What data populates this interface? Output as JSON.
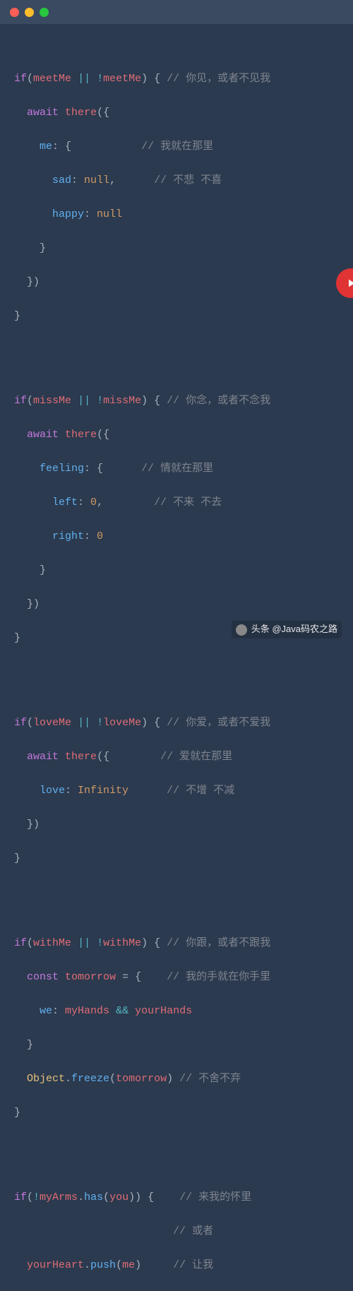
{
  "window": {
    "dots": [
      "close",
      "minimize",
      "zoom"
    ]
  },
  "blocks": [
    {
      "if_lhs": "meetMe",
      "if_rhs": "meetMe",
      "neg_rhs": true,
      "cmt_if": "你见，或者不见我",
      "await_call": "there",
      "nested_key": "me",
      "cmt_await": "我就在那里",
      "props": [
        {
          "name": "sad",
          "value": "null",
          "cmt": "不悲 不喜"
        },
        {
          "name": "happy",
          "value": "null"
        }
      ]
    },
    {
      "if_lhs": "missMe",
      "if_rhs": "missMe",
      "neg_rhs": true,
      "cmt_if": "你念，或者不念我",
      "await_call": "there",
      "nested_key": "feeling",
      "cmt_await": "情就在那里",
      "props": [
        {
          "name": "left",
          "value": "0",
          "cmt": "不来 不去"
        },
        {
          "name": "right",
          "value": "0"
        }
      ]
    },
    {
      "if_lhs": "loveMe",
      "if_rhs": "loveMe",
      "neg_rhs": true,
      "cmt_if": "你爱，或者不爱我",
      "await_call": "there",
      "cmt_await": "爱就在那里",
      "flat_props": [
        {
          "name": "love",
          "value": "Infinity",
          "cmt": "不增 不减"
        }
      ]
    }
  ],
  "with_block": {
    "if_lhs": "withMe",
    "if_rhs": "withMe",
    "cmt_if": "你跟，或者不跟我",
    "const_name": "tomorrow",
    "cmt_const": "我的手就在你手里",
    "key": "we",
    "lhs": "myHands",
    "rhs": "yourHands",
    "freeze_obj": "Object",
    "freeze_fn": "freeze",
    "freeze_arg": "tomorrow",
    "cmt_freeze": "不舍不弃"
  },
  "arms_block": {
    "obj": "myArms",
    "method": "has",
    "arg": "you",
    "cmt1": "来我的怀里",
    "cmt2": "或者",
    "push_obj": "yourHeart",
    "push_fn": "push",
    "push_arg": "me",
    "cmt3": "让我"
  },
  "attribution": {
    "label": "头条 @Java码农之路"
  }
}
